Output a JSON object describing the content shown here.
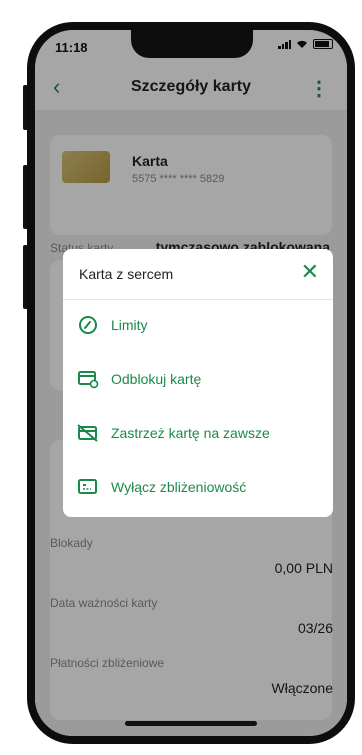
{
  "status_bar": {
    "time": "11:18"
  },
  "header": {
    "back_icon": "chevron-left-icon",
    "title": "Szczegóły karty",
    "menu_icon": "kebab-menu-icon"
  },
  "card": {
    "name": "Karta",
    "number": "5575 **** **** 5829",
    "status_label": "Status karty",
    "status_value": "tymczasowo zablokowana"
  },
  "details": [
    {
      "label": "Blokady",
      "value": "0,00 PLN"
    },
    {
      "label": "Data ważności karty",
      "value": "03/26"
    },
    {
      "label": "Płatności zbliżeniowe",
      "value": "Włączone"
    }
  ],
  "modal": {
    "title": "Karta z sercem",
    "options": [
      {
        "label": "Limity",
        "icon": "gauge-icon"
      },
      {
        "label": "Odblokuj kartę",
        "icon": "card-unlock-icon"
      },
      {
        "label": "Zastrzeż kartę na zawsze",
        "icon": "card-block-icon"
      },
      {
        "label": "Wyłącz zbliżeniowość",
        "icon": "contactless-card-icon"
      }
    ]
  },
  "colors": {
    "accent": "#1a8a4a",
    "backdrop": "#efefef"
  }
}
